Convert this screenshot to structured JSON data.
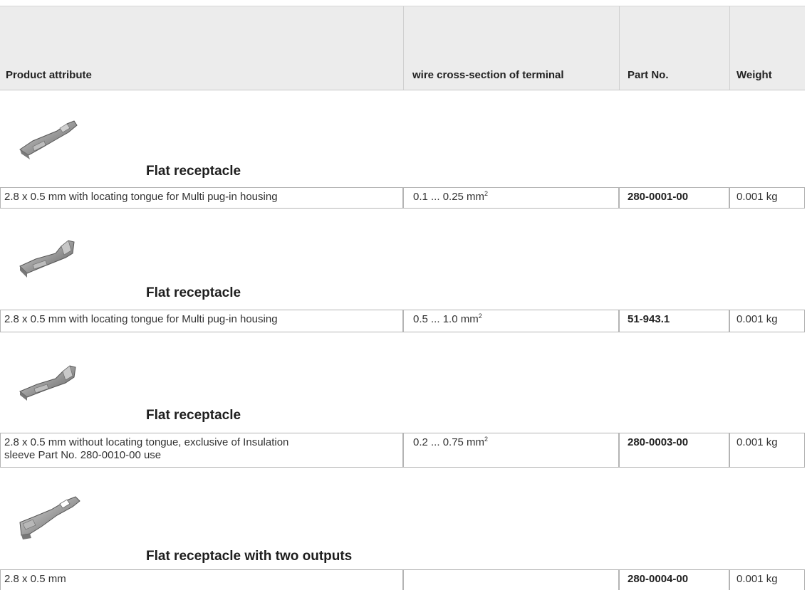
{
  "header": {
    "product_attribute": "Product attribute",
    "wire_cross_section": "wire cross-section of terminal",
    "part_no": "Part No.",
    "weight": "Weight"
  },
  "products": [
    {
      "title": "Flat receptacle",
      "description": "2.8 x 0.5 mm with locating tongue for Multi pug-in housing",
      "wire_value": "0.1 ... 0.25 mm",
      "wire_sup": "2",
      "part_no": "280-0001-00",
      "weight": "0.001 kg",
      "image_icon": "flat-receptacle-image"
    },
    {
      "title": "Flat receptacle",
      "description": "2.8 x 0.5 mm with locating tongue for Multi pug-in housing",
      "wire_value": "0.5 ... 1.0 mm",
      "wire_sup": "2",
      "part_no": "51-943.1",
      "weight": "0.001 kg",
      "image_icon": "flat-receptacle-image"
    },
    {
      "title": "Flat receptacle",
      "description_line1": "2.8 x 0.5 mm without locating tongue, exclusive of Insulation",
      "description_line2": "sleeve Part No. 280-0010-00 use",
      "wire_value": "0.2 ... 0.75 mm",
      "wire_sup": "2",
      "part_no": "280-0003-00",
      "weight": "0.001 kg",
      "image_icon": "flat-receptacle-image"
    },
    {
      "title": "Flat receptacle with two outputs",
      "description": "2.8 x 0.5 mm",
      "wire_value": "",
      "part_no": "280-0004-00",
      "weight": "0.001 kg",
      "image_icon": "flat-receptacle-two-outputs-image"
    }
  ]
}
